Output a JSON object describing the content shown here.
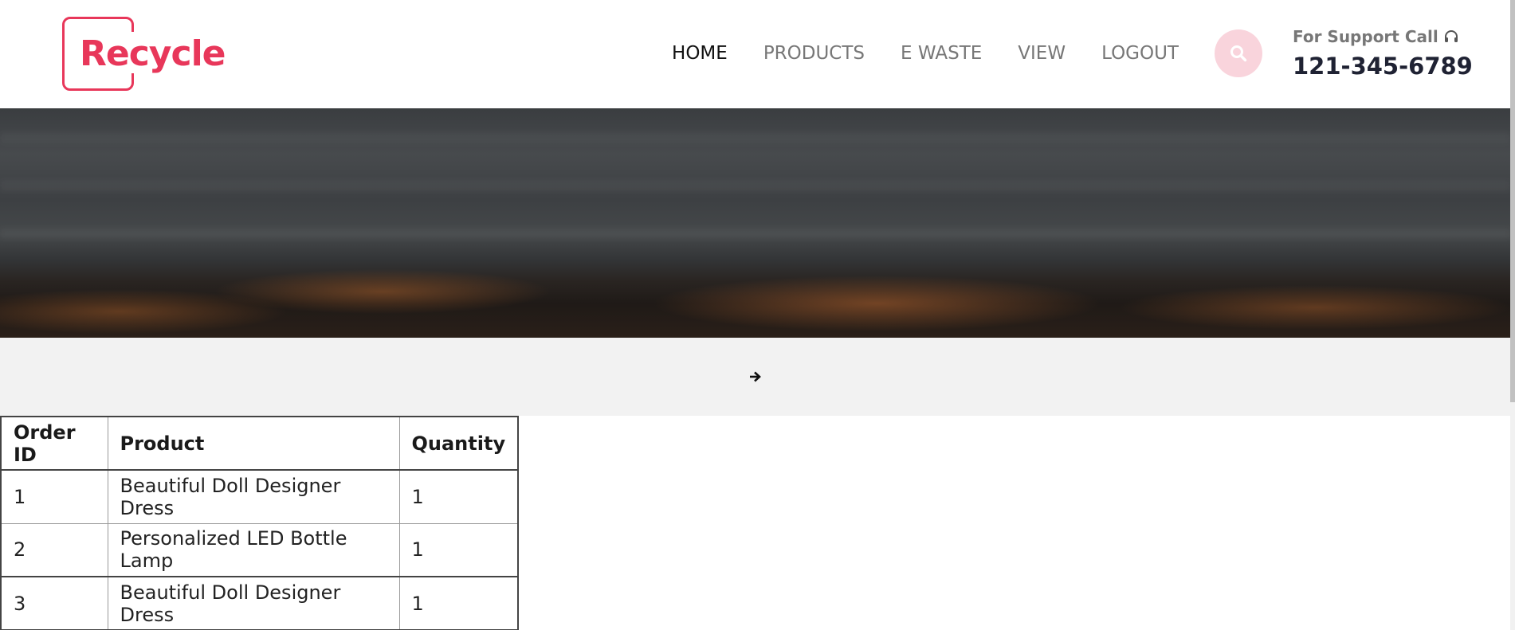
{
  "brand": {
    "logo_text": "Recycle",
    "color": "#e8375a"
  },
  "nav": {
    "items": [
      {
        "label": "HOME",
        "active": true
      },
      {
        "label": "PRODUCTS",
        "active": false
      },
      {
        "label": "E WASTE",
        "active": false
      },
      {
        "label": "VIEW",
        "active": false
      },
      {
        "label": "LOGOUT",
        "active": false
      }
    ]
  },
  "search": {
    "icon": "search-icon",
    "bg_color": "#f9d4dc"
  },
  "support": {
    "label": "For Support Call",
    "icon": "headset-icon",
    "phone": "121-345-6789"
  },
  "breadcrumb": {
    "icon": "arrow-right-icon"
  },
  "orders_table": {
    "headers": [
      "Order ID",
      "Product",
      "Quantity"
    ],
    "rows": [
      [
        "1",
        "Beautiful Doll Designer Dress",
        "1"
      ],
      [
        "2",
        "Personalized LED Bottle Lamp",
        "1"
      ],
      [
        "3",
        "Beautiful Doll Designer Dress",
        "1"
      ]
    ]
  }
}
